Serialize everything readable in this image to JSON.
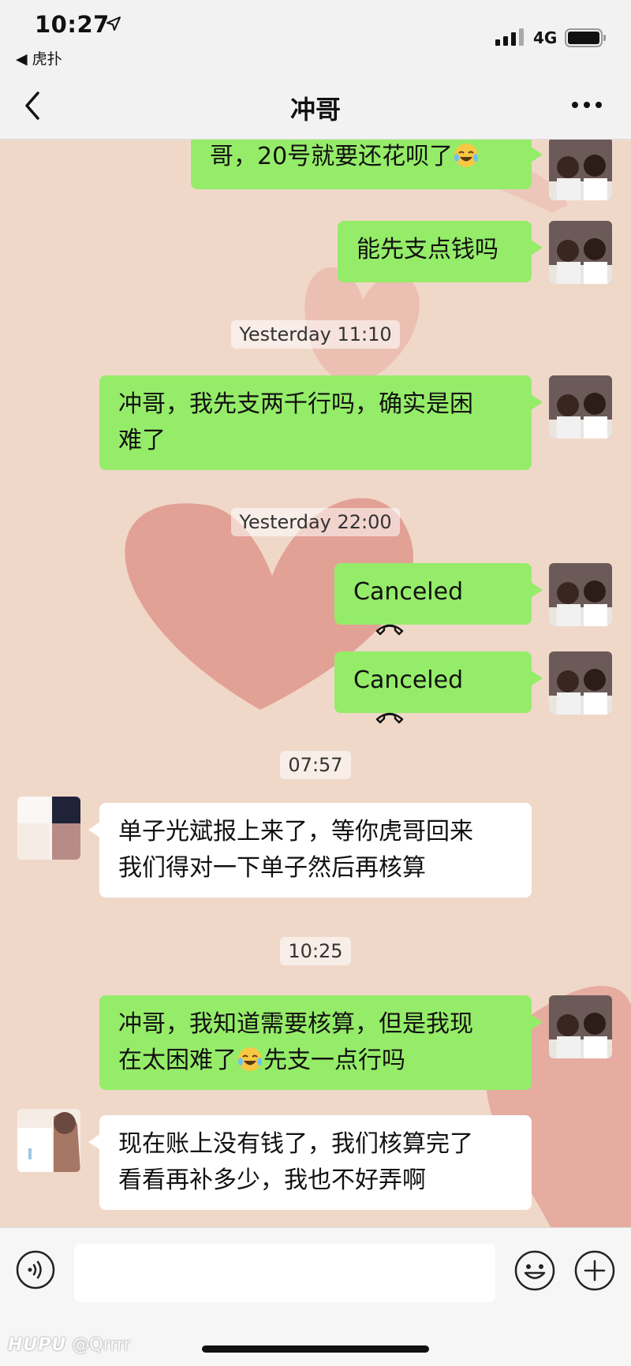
{
  "status_bar": {
    "time": "10:27",
    "back_app": "◀ 虎扑",
    "network": "4G",
    "icons": [
      "location-arrow-icon",
      "signal-icon",
      "battery-icon"
    ]
  },
  "nav": {
    "title": "冲哥",
    "icons": [
      "back-chevron-icon",
      "more-dots-icon"
    ]
  },
  "messages": [
    {
      "type": "sent",
      "text": "哥，20号就要还花呗了",
      "emoji": "crying-laughing-emoji"
    },
    {
      "type": "sent",
      "text": "能先支点钱吗"
    },
    {
      "type": "timestamp",
      "text": "Yesterday 11:10"
    },
    {
      "type": "sent",
      "line1": "冲哥，我先支两千行吗，确实是困",
      "line2": "难了"
    },
    {
      "type": "timestamp",
      "text": "Yesterday 22:00"
    },
    {
      "type": "call",
      "text": "Canceled",
      "icon": "hangup-phone-icon"
    },
    {
      "type": "call",
      "text": "Canceled",
      "icon": "hangup-phone-icon"
    },
    {
      "type": "timestamp",
      "text": "07:57"
    },
    {
      "type": "recv",
      "line1": "单子光斌报上来了，等你虎哥回来",
      "line2": "我们得对一下单子然后再核算"
    },
    {
      "type": "timestamp",
      "text": "10:25"
    },
    {
      "type": "sent",
      "line1": "冲哥，我知道需要核算，但是我现",
      "line2a": "在太困难了",
      "line2b": "先支一点行吗",
      "emoji": "crying-laughing-emoji"
    },
    {
      "type": "recv",
      "line1": "现在账上没有钱了，我们核算完了",
      "line2": "看看再补多少，我也不好弄啊"
    }
  ],
  "input_bar": {
    "placeholder": "",
    "icons": [
      "voice-icon",
      "emoji-face-icon",
      "plus-icon"
    ]
  },
  "watermark": {
    "brand": "HUPU",
    "user": "@Qrrrr"
  },
  "colors": {
    "sent_bubble": "#95ec69",
    "recv_bubble": "#ffffff",
    "background": "#f0d8c9",
    "heart": "#de8f83"
  }
}
